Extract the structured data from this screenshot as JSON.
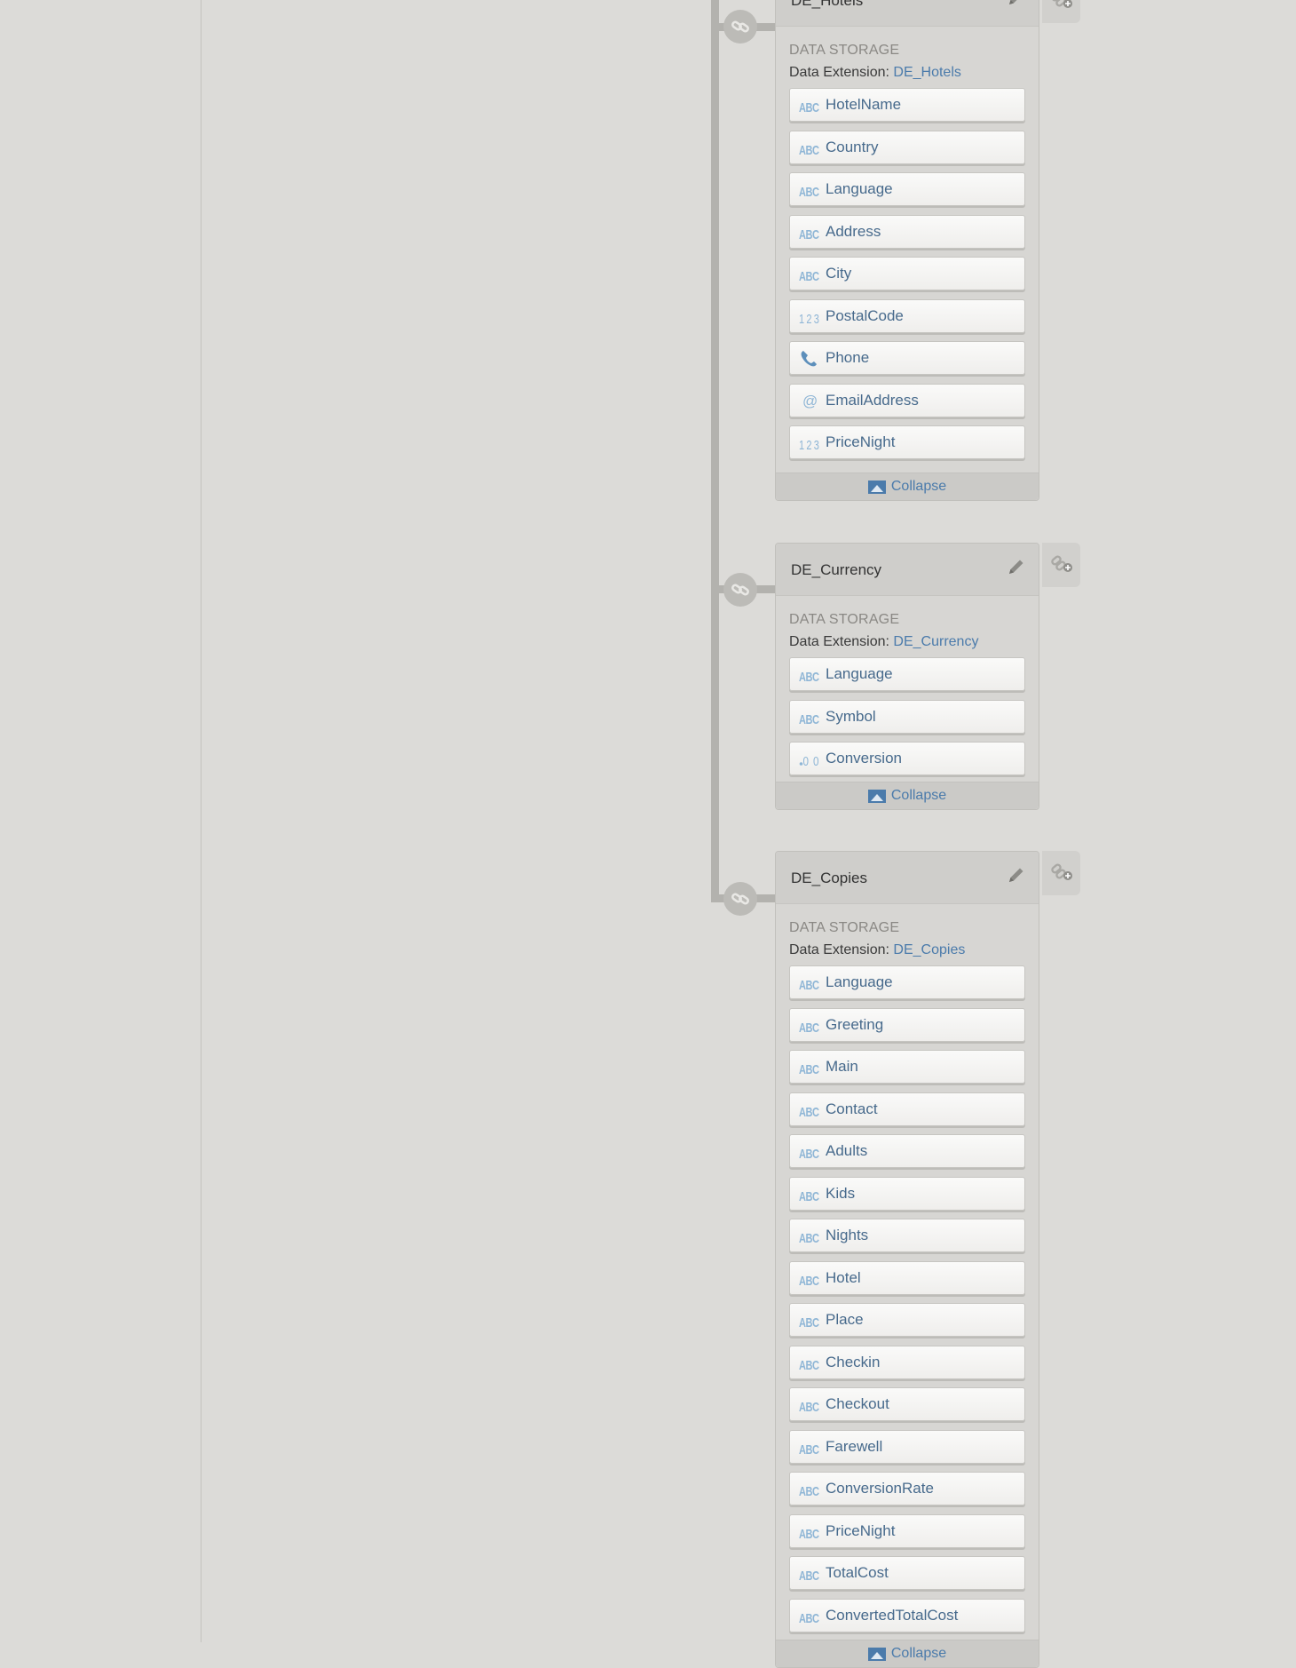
{
  "storage_label": "DATA STORAGE",
  "de_prefix": "Data Extension:",
  "collapse_label": "Collapse",
  "accent_color": "#4b7bab",
  "icon_names": {
    "text": "abc-text-icon",
    "number": "123-number-icon",
    "phone": "phone-icon",
    "email": "at-email-icon",
    "decimal": "decimal-icon"
  },
  "cards": [
    {
      "title": "DE_Hotels",
      "de_name": "DE_Hotels",
      "fields": [
        {
          "label": "HotelName",
          "type": "text"
        },
        {
          "label": "Country",
          "type": "text"
        },
        {
          "label": "Language",
          "type": "text"
        },
        {
          "label": "Address",
          "type": "text"
        },
        {
          "label": "City",
          "type": "text"
        },
        {
          "label": "PostalCode",
          "type": "number"
        },
        {
          "label": "Phone",
          "type": "phone"
        },
        {
          "label": "EmailAddress",
          "type": "email"
        },
        {
          "label": "PriceNight",
          "type": "number"
        }
      ]
    },
    {
      "title": "DE_Currency",
      "de_name": "DE_Currency",
      "fields": [
        {
          "label": "Language",
          "type": "text"
        },
        {
          "label": "Symbol",
          "type": "text"
        },
        {
          "label": "Conversion",
          "type": "decimal"
        }
      ]
    },
    {
      "title": "DE_Copies",
      "de_name": "DE_Copies",
      "fields": [
        {
          "label": "Language",
          "type": "text"
        },
        {
          "label": "Greeting",
          "type": "text"
        },
        {
          "label": "Main",
          "type": "text"
        },
        {
          "label": "Contact",
          "type": "text"
        },
        {
          "label": "Adults",
          "type": "text"
        },
        {
          "label": "Kids",
          "type": "text"
        },
        {
          "label": "Nights",
          "type": "text"
        },
        {
          "label": "Hotel",
          "type": "text"
        },
        {
          "label": "Place",
          "type": "text"
        },
        {
          "label": "Checkin",
          "type": "text"
        },
        {
          "label": "Checkout",
          "type": "text"
        },
        {
          "label": "Farewell",
          "type": "text"
        },
        {
          "label": "ConversionRate",
          "type": "text"
        },
        {
          "label": "PriceNight",
          "type": "text"
        },
        {
          "label": "TotalCost",
          "type": "text"
        },
        {
          "label": "ConvertedTotalCost",
          "type": "text"
        }
      ]
    }
  ]
}
